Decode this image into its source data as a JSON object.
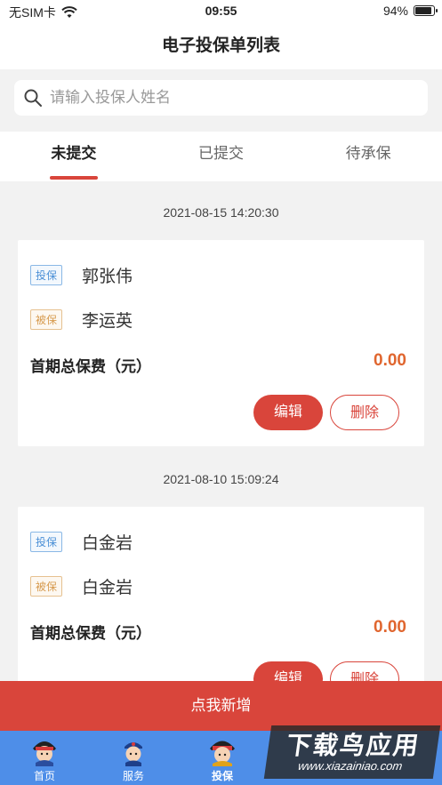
{
  "status_bar": {
    "carrier": "无SIM卡",
    "time": "09:55",
    "battery": "94%"
  },
  "nav": {
    "title": "电子投保单列表"
  },
  "search": {
    "placeholder": "请输入投保人姓名"
  },
  "tabs": [
    {
      "label": "未提交",
      "active": true
    },
    {
      "label": "已提交",
      "active": false
    },
    {
      "label": "待承保",
      "active": false
    }
  ],
  "records": [
    {
      "date": "2021-08-15 14:20:30",
      "applicant_tag": "投保",
      "applicant": "郭张伟",
      "insured_tag": "被保",
      "insured": "李运英",
      "premium_label": "首期总保费（元）",
      "premium": "0.00",
      "edit_label": "编辑",
      "delete_label": "删除"
    },
    {
      "date": "2021-08-10 15:09:24",
      "applicant_tag": "投保",
      "applicant": "白金岩",
      "insured_tag": "被保",
      "insured": "白金岩",
      "premium_label": "首期总保费（元）",
      "premium": "0.00",
      "edit_label": "编辑",
      "delete_label": "删除"
    }
  ],
  "add_button": {
    "label": "点我新增"
  },
  "tabbar": [
    {
      "label": "首页",
      "icon": "avatar-icon"
    },
    {
      "label": "服务",
      "icon": "avatar-icon"
    },
    {
      "label": "投保",
      "icon": "avatar-icon",
      "active": true
    }
  ],
  "watermark": {
    "main": "下载鸟应用",
    "sub": "www.xiazainiao.com"
  },
  "colors": {
    "accent": "#d9453b",
    "premium": "#e0662f",
    "tabbar": "#4e8ee8",
    "tag_blue": "#4a8fd6",
    "tag_orange": "#d79b4f"
  }
}
